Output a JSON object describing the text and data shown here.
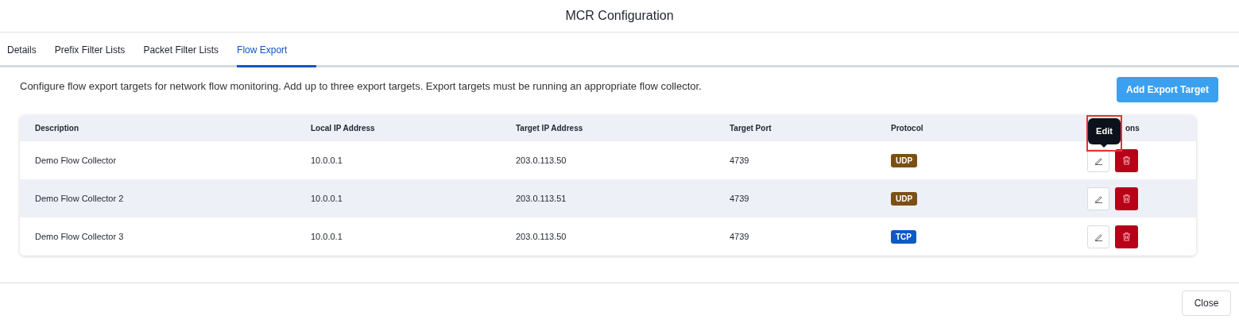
{
  "dialog": {
    "title": "MCR Configuration"
  },
  "tabs": [
    {
      "label": "Details",
      "selected": false
    },
    {
      "label": "Prefix Filter Lists",
      "selected": false
    },
    {
      "label": "Packet Filter Lists",
      "selected": false
    },
    {
      "label": "Flow Export",
      "selected": true
    }
  ],
  "description": "Configure flow export targets for network flow monitoring. Add up to three export targets. Export targets must be running an appropriate flow collector.",
  "add_button": "Add Export Target",
  "table": {
    "columns": [
      "Description",
      "Local IP Address",
      "Target IP Address",
      "Target Port",
      "Protocol",
      "ons"
    ],
    "rows": [
      {
        "description": "Demo Flow Collector",
        "local_ip": "10.0.0.1",
        "target_ip": "203.0.113.50",
        "port": "4739",
        "protocol": {
          "label": "UDP",
          "color": "#7b4f16"
        }
      },
      {
        "description": "Demo Flow Collector 2",
        "local_ip": "10.0.0.1",
        "target_ip": "203.0.113.51",
        "port": "4739",
        "protocol": {
          "label": "UDP",
          "color": "#7b4f16"
        }
      },
      {
        "description": "Demo Flow Collector 3",
        "local_ip": "10.0.0.1",
        "target_ip": "203.0.113.50",
        "port": "4739",
        "protocol": {
          "label": "TCP",
          "color": "#0b5bc2"
        }
      }
    ]
  },
  "tooltip": {
    "text": "Edit"
  },
  "close_button": "Close"
}
